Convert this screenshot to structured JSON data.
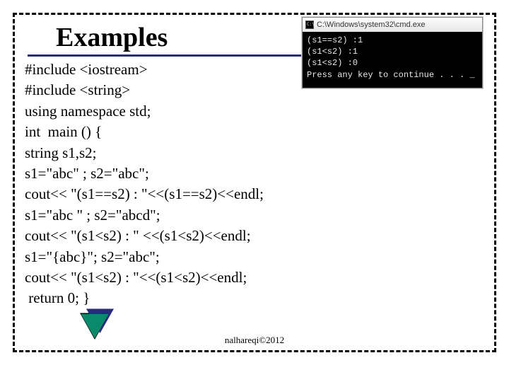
{
  "title": "Examples",
  "code_lines": [
    "#include <iostream>",
    "#include <string>",
    "using namespace std;",
    "int  main () {",
    "string s1,s2;",
    "s1=\"abc\" ; s2=\"abc\";",
    "cout<< \"(s1==s2) : \"<<(s1==s2)<<endl;",
    "s1=\"abc \" ; s2=\"abcd\";",
    "cout<< \"(s1<s2) : \" <<(s1<s2)<<endl;",
    "s1=\"{abc}\"; s2=\"abc\";",
    "cout<< \"(s1<s2) : \"<<(s1<s2)<<endl;",
    " return 0; }"
  ],
  "console": {
    "title": "C:\\Windows\\system32\\cmd.exe",
    "lines": [
      "(s1==s2) :1",
      "(s1<s2) :1",
      "(s1<s2) :0",
      "Press any key to continue . . . _"
    ]
  },
  "footer": "nalhareqi©2012"
}
